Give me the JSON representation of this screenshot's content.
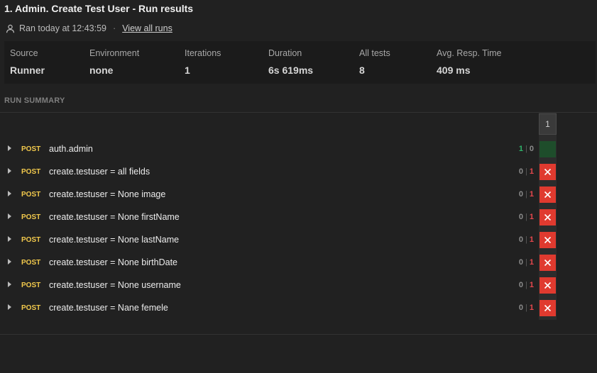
{
  "header": {
    "title": "1. Admin. Create Test User - Run results",
    "ran_text": "Ran today at 12:43:59",
    "separator": "·",
    "view_all_runs": "View all runs"
  },
  "stats": [
    {
      "label": "Source",
      "value": "Runner"
    },
    {
      "label": "Environment",
      "value": "none"
    },
    {
      "label": "Iterations",
      "value": "1"
    },
    {
      "label": "Duration",
      "value": "6s 619ms"
    },
    {
      "label": "All tests",
      "value": "8"
    },
    {
      "label": "Avg. Resp. Time",
      "value": "409 ms"
    }
  ],
  "summary": {
    "section_label": "RUN SUMMARY",
    "iteration_header": "1",
    "rows": [
      {
        "method": "POST",
        "name": "auth.admin",
        "passed": "1",
        "failed": "0",
        "status": "pass"
      },
      {
        "method": "POST",
        "name": "create.testuser = all fields",
        "passed": "0",
        "failed": "1",
        "status": "fail"
      },
      {
        "method": "POST",
        "name": "create.testuser = None image",
        "passed": "0",
        "failed": "1",
        "status": "fail"
      },
      {
        "method": "POST",
        "name": "create.testuser = None firstName",
        "passed": "0",
        "failed": "1",
        "status": "fail"
      },
      {
        "method": "POST",
        "name": "create.testuser = None lastName",
        "passed": "0",
        "failed": "1",
        "status": "fail"
      },
      {
        "method": "POST",
        "name": "create.testuser = None birthDate",
        "passed": "0",
        "failed": "1",
        "status": "fail"
      },
      {
        "method": "POST",
        "name": "create.testuser = None username",
        "passed": "0",
        "failed": "1",
        "status": "fail"
      },
      {
        "method": "POST",
        "name": "create.testuser = Nane femele",
        "passed": "0",
        "failed": "1",
        "status": "fail"
      }
    ]
  },
  "colors": {
    "method_post": "#f2c94c",
    "pass": "#2fb36a",
    "fail": "#e5484d",
    "fail_cell": "#e03a2f",
    "pass_cell": "#1e4d2b"
  },
  "icons": {
    "user": "person-icon",
    "expand": "caret-right-icon",
    "fail": "close-icon"
  }
}
